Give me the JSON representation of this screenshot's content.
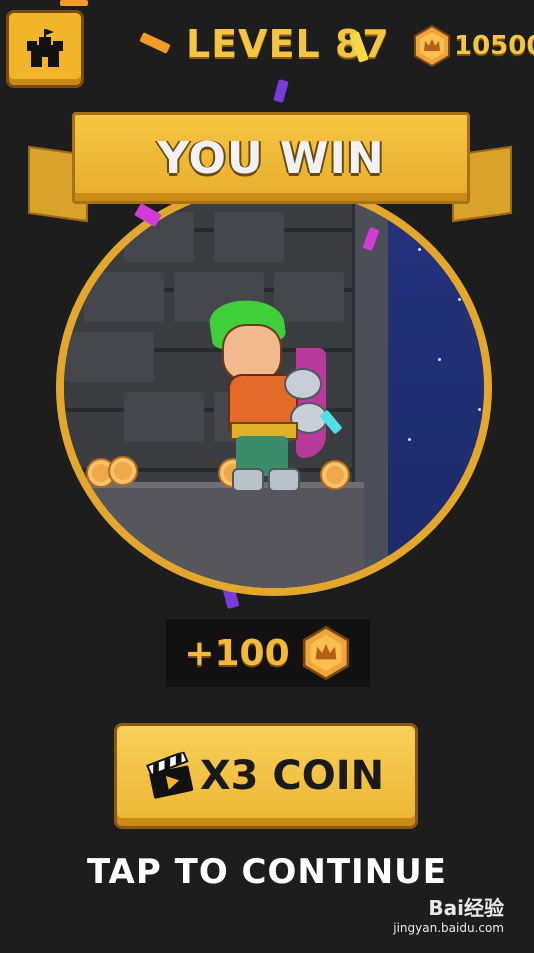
{
  "header": {
    "level_label": "LEVEL 87",
    "coin_total": "10500",
    "home_icon": "castle-icon"
  },
  "banner": {
    "title": "YOU WIN"
  },
  "reward": {
    "amount": "+100",
    "icon": "crown-coin-icon"
  },
  "bonus_button": {
    "label": "X3 COIN",
    "icon": "video-clapper-icon"
  },
  "continue_text": "TAP TO CONTINUE",
  "watermark": {
    "brand": "Bai经验",
    "url": "jingyan.baidu.com"
  },
  "colors": {
    "background": "#1d1d1d",
    "gold": "#f4c443",
    "button": "#f2b52a",
    "night_sky": "#25337e",
    "hero_hair": "#3fcf3a"
  }
}
